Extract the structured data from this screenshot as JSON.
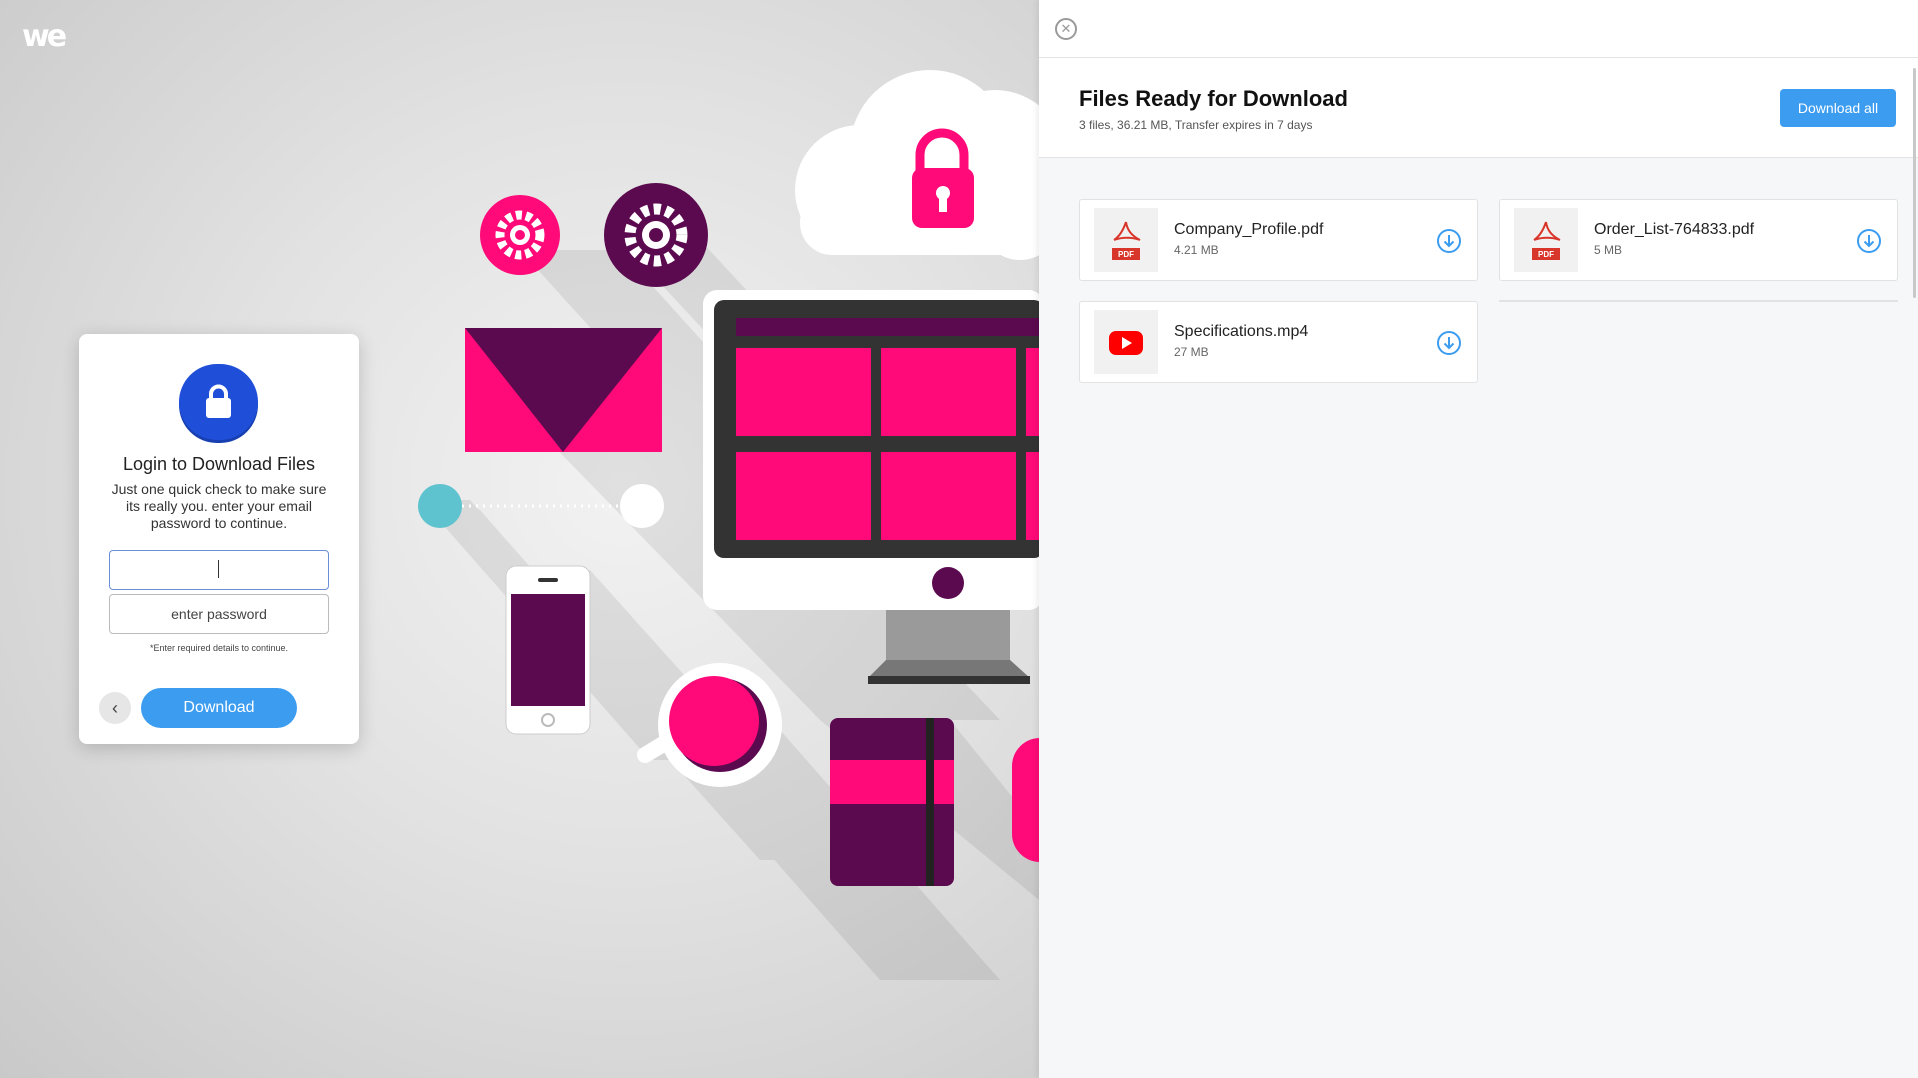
{
  "brand": {
    "logo_text": "we"
  },
  "login": {
    "title": "Login to Download Files",
    "description": "Just one quick check to make sure its really you. enter your email password to continue.",
    "email_value": "",
    "password_placeholder": "enter password",
    "hint": "*Enter required details to continue.",
    "download_label": "Download",
    "back_icon": "chevron-left-icon"
  },
  "panel": {
    "close_icon": "close-icon",
    "title": "Files Ready for Download",
    "subtitle": "3 files, 36.21 MB, Transfer expires in 7 days",
    "download_all_label": "Download all",
    "files": [
      {
        "name": "Company_Profile.pdf",
        "size": "4.21 MB",
        "icon": "pdf-icon",
        "badge": "PDF"
      },
      {
        "name": "Order_List-764833.pdf",
        "size": "5 MB",
        "icon": "pdf-icon",
        "badge": "PDF"
      },
      {
        "name": "Specifications.mp4",
        "size": "27 MB",
        "icon": "youtube-icon"
      }
    ]
  },
  "colors": {
    "accent_blue": "#3b9cf0",
    "lock_blue": "#1f4fd8",
    "magenta": "#ff0a78",
    "purple": "#5c0a4f",
    "pdf_red": "#d9362b",
    "youtube_red": "#ff0000"
  }
}
